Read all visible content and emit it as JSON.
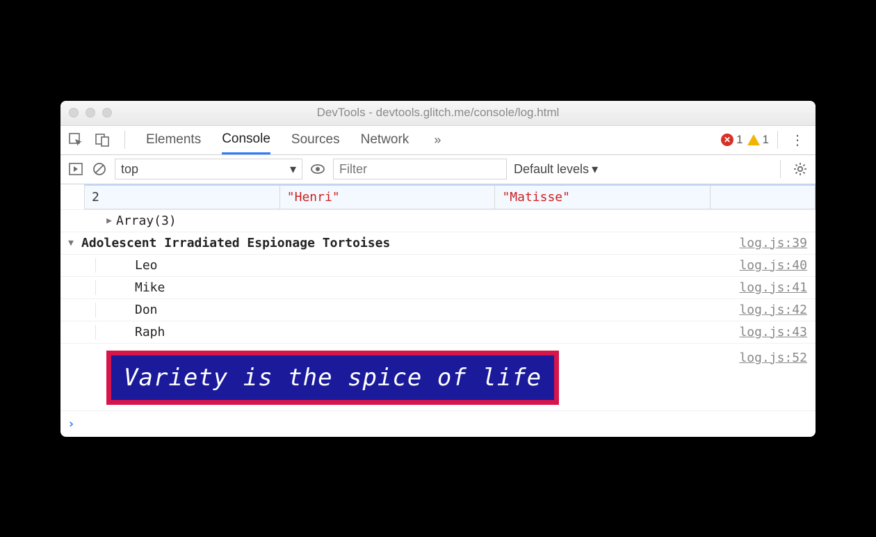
{
  "window": {
    "title": "DevTools - devtools.glitch.me/console/log.html"
  },
  "tabs": {
    "items": [
      "Elements",
      "Console",
      "Sources",
      "Network"
    ],
    "active_index": 1
  },
  "badges": {
    "errors": "1",
    "warnings": "1"
  },
  "toolbar": {
    "context": "top",
    "filter_placeholder": "Filter",
    "levels_label": "Default levels"
  },
  "table": {
    "index": "2",
    "first": "\"Henri\"",
    "last": "\"Matisse\""
  },
  "array_summary": "Array(3)",
  "group": {
    "title": "Adolescent Irradiated Espionage Tortoises",
    "source": "log.js:39",
    "items": [
      {
        "text": "Leo",
        "source": "log.js:40"
      },
      {
        "text": "Mike",
        "source": "log.js:41"
      },
      {
        "text": "Don",
        "source": "log.js:42"
      },
      {
        "text": "Raph",
        "source": "log.js:43"
      }
    ]
  },
  "styled": {
    "text": "Variety is the spice of life",
    "source": "log.js:52"
  }
}
